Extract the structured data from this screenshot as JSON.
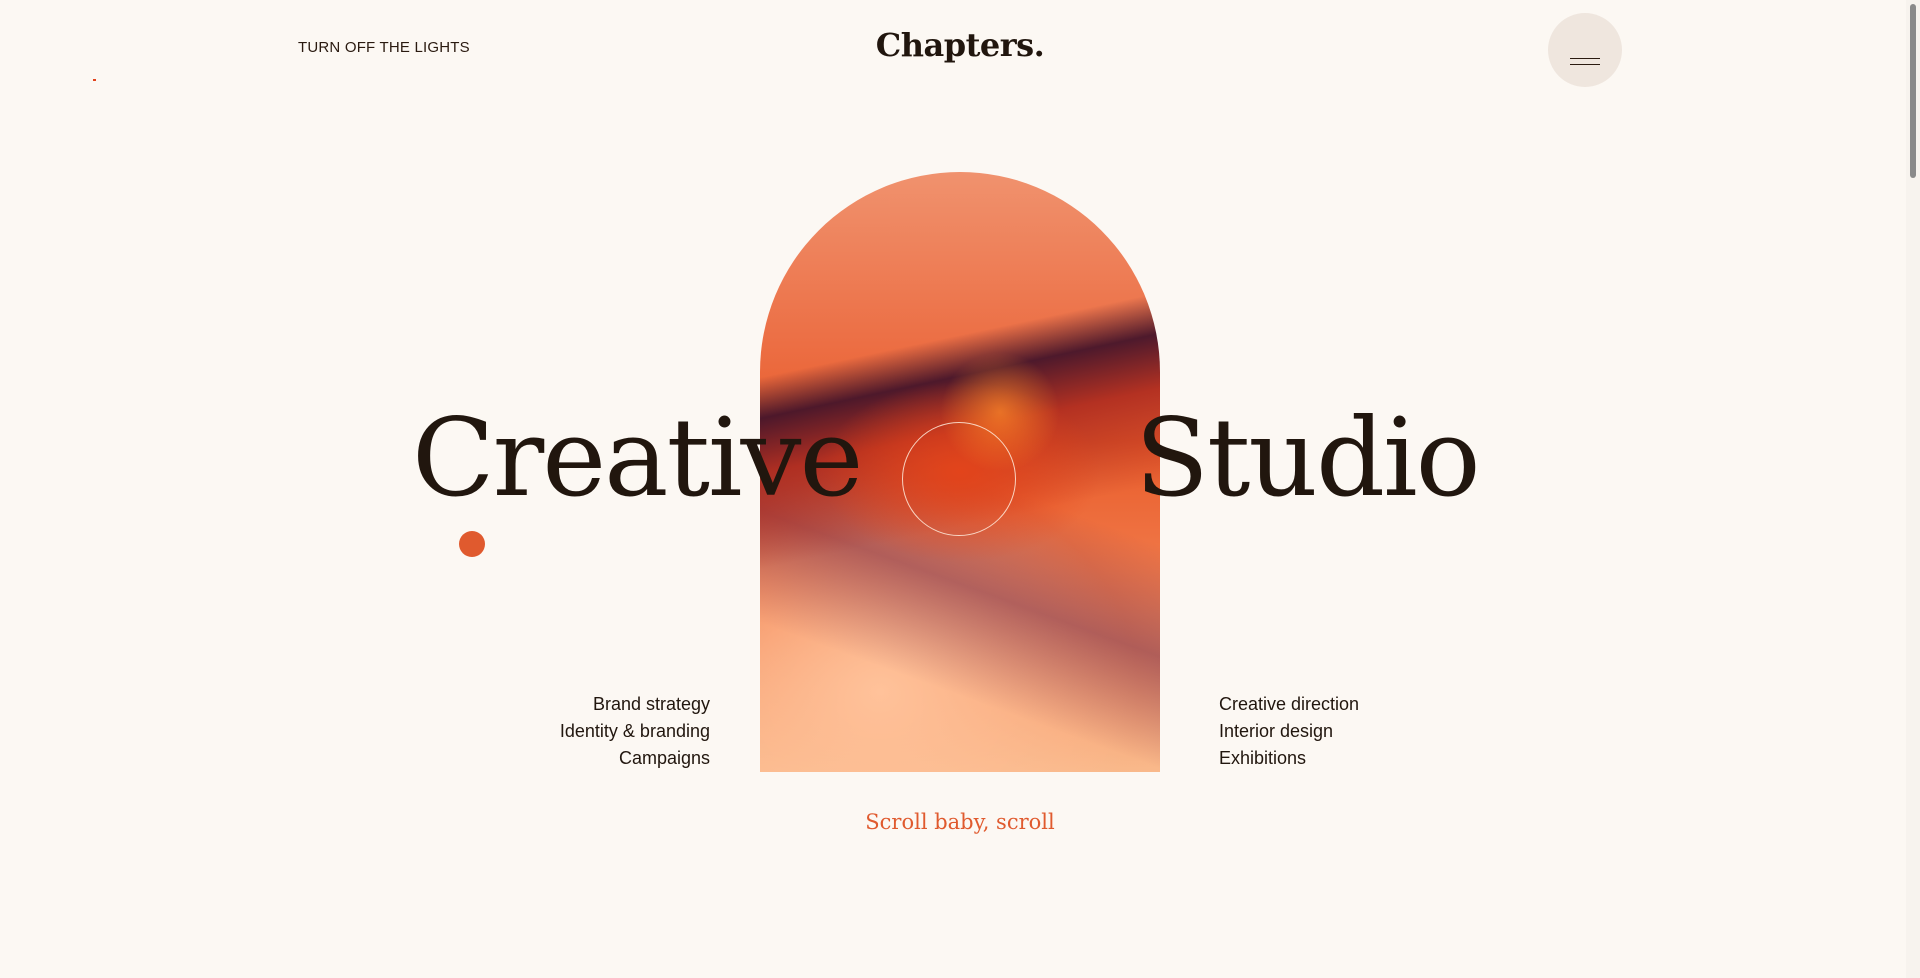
{
  "header": {
    "lights_toggle": "TURN OFF THE LIGHTS",
    "logo": "Chapters.",
    "menu_icon": "hamburger-icon"
  },
  "hero": {
    "word_left": "Creative",
    "word_right": "Studio",
    "services_left": [
      "Brand strategy",
      "Identity & branding",
      "Campaigns"
    ],
    "services_right": [
      "Creative direction",
      "Interior design",
      "Exhibitions"
    ],
    "scroll_cta": "Scroll baby, scroll"
  },
  "colors": {
    "background": "#fcf8f3",
    "text": "#21160e",
    "accent": "#e05a2e",
    "menu_button": "#efe6de"
  }
}
